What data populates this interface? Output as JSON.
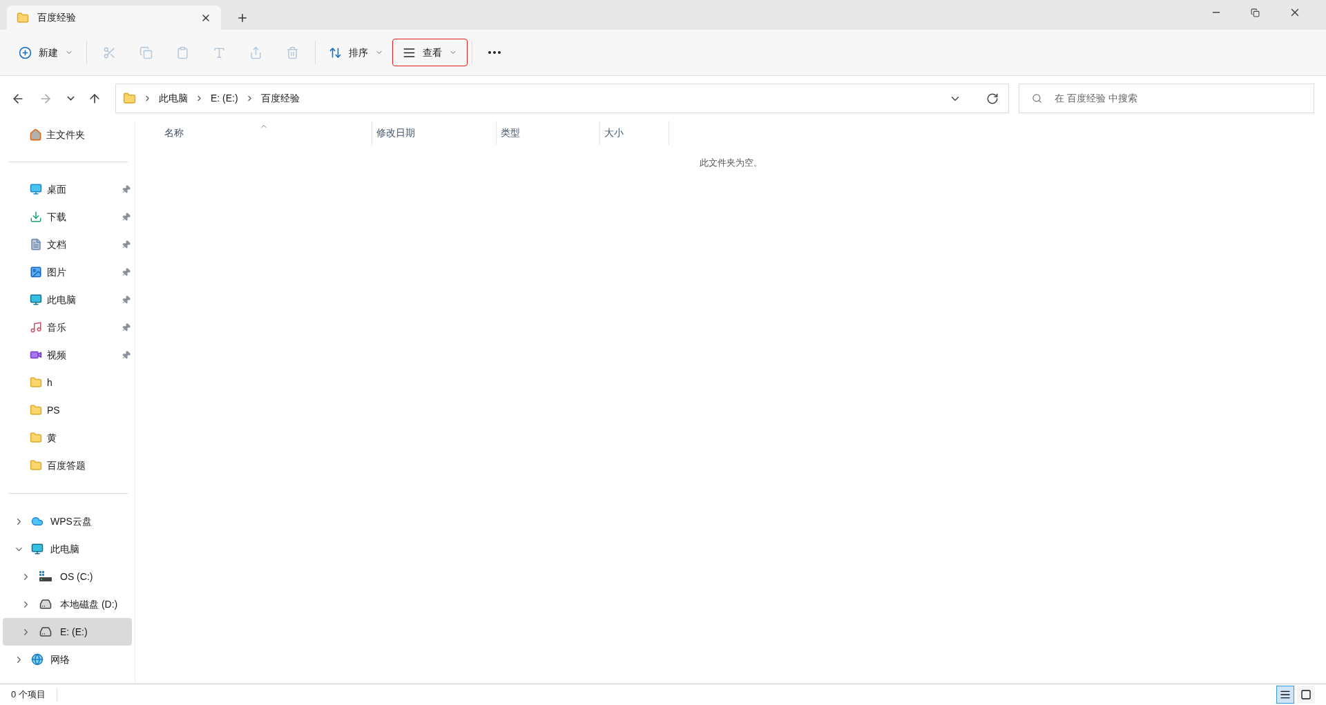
{
  "tab": {
    "title": "百度经验"
  },
  "toolbar": [
    {
      "kind": "new",
      "label": "新建",
      "disabled": false,
      "highlighted": false
    },
    {
      "kind": "cut",
      "disabled": true,
      "highlighted": false
    },
    {
      "kind": "copy",
      "disabled": true,
      "highlighted": false
    },
    {
      "kind": "paste",
      "disabled": true,
      "highlighted": false
    },
    {
      "kind": "rename",
      "disabled": true,
      "highlighted": false
    },
    {
      "kind": "share",
      "disabled": true,
      "highlighted": false
    },
    {
      "kind": "delete",
      "disabled": true,
      "highlighted": false
    },
    {
      "kind": "sort",
      "label": "排序",
      "disabled": false,
      "highlighted": false
    },
    {
      "kind": "view",
      "label": "查看",
      "disabled": false,
      "highlighted": true
    },
    {
      "kind": "more",
      "disabled": false,
      "highlighted": false
    }
  ],
  "address": {
    "breadcrumbs": [
      "此电脑",
      "E: (E:)",
      "百度经验"
    ]
  },
  "search": {
    "placeholder": "在 百度经验 中搜索"
  },
  "sidebar": {
    "home": {
      "label": "主文件夹"
    },
    "quick_access": [
      {
        "kind": "desktop",
        "label": "桌面",
        "pinned": true
      },
      {
        "kind": "downloads",
        "label": "下载",
        "pinned": true
      },
      {
        "kind": "documents",
        "label": "文档",
        "pinned": true
      },
      {
        "kind": "pictures",
        "label": "图片",
        "pinned": true
      },
      {
        "kind": "computer",
        "label": "此电脑",
        "pinned": true
      },
      {
        "kind": "music",
        "label": "音乐",
        "pinned": true
      },
      {
        "kind": "videos",
        "label": "视频",
        "pinned": true
      },
      {
        "kind": "folder",
        "label": "h",
        "pinned": false
      },
      {
        "kind": "folder",
        "label": "PS",
        "pinned": false
      },
      {
        "kind": "folder",
        "label": "黄",
        "pinned": false
      },
      {
        "kind": "folder",
        "label": "百度答题",
        "pinned": false
      }
    ],
    "tree": [
      {
        "kind": "cloud",
        "label": "WPS云盘",
        "expanded": false,
        "selected": false
      },
      {
        "kind": "computer",
        "label": "此电脑",
        "expanded": true,
        "selected": false,
        "children": [
          {
            "kind": "systemdrive",
            "label": "OS (C:)",
            "expanded": false,
            "selected": false
          },
          {
            "kind": "drive",
            "label": "本地磁盘 (D:)",
            "expanded": false,
            "selected": false
          },
          {
            "kind": "drive",
            "label": "E: (E:)",
            "expanded": false,
            "selected": true
          }
        ]
      },
      {
        "kind": "network",
        "label": "网络",
        "expanded": false,
        "selected": false
      }
    ]
  },
  "table": {
    "columns": [
      {
        "label": "名称",
        "sorted": true
      },
      {
        "label": "修改日期",
        "sorted": false
      },
      {
        "label": "类型",
        "sorted": false
      },
      {
        "label": "大小",
        "sorted": false
      }
    ],
    "empty_message": "此文件夹为空。"
  },
  "status_bar": {
    "count": "0 个项目",
    "views": [
      {
        "kind": "details",
        "selected": true
      },
      {
        "kind": "tiles",
        "selected": false
      }
    ]
  }
}
